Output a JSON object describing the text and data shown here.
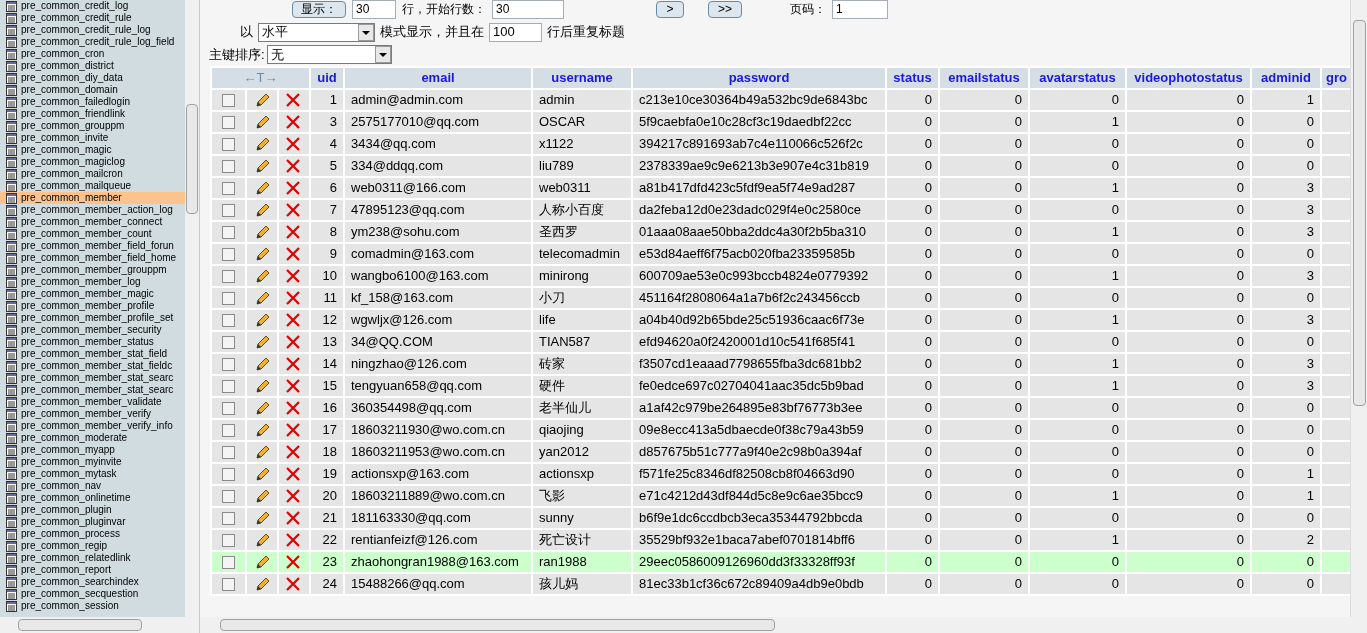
{
  "toolbar": {
    "show_button": "显示：",
    "rows_value": "30",
    "rows_label": "行，开始行数：",
    "start_value": "30",
    "next_button": ">",
    "last_button": ">>",
    "page_label": "页码：",
    "page_value": "1"
  },
  "display": {
    "prefix": "以",
    "mode_value": "水平",
    "mode_label": "模式显示，并且在",
    "repeat_value": "100",
    "repeat_label": "行后重复标题"
  },
  "sort": {
    "label": "主键排序:",
    "value": "无"
  },
  "sidebar": {
    "items": [
      {
        "label": "pre_common_credit_log",
        "selected": false
      },
      {
        "label": "pre_common_credit_rule",
        "selected": false
      },
      {
        "label": "pre_common_credit_rule_log",
        "selected": false
      },
      {
        "label": "pre_common_credit_rule_log_field",
        "selected": false
      },
      {
        "label": "pre_common_cron",
        "selected": false
      },
      {
        "label": "pre_common_district",
        "selected": false
      },
      {
        "label": "pre_common_diy_data",
        "selected": false
      },
      {
        "label": "pre_common_domain",
        "selected": false
      },
      {
        "label": "pre_common_failedlogin",
        "selected": false
      },
      {
        "label": "pre_common_friendlink",
        "selected": false
      },
      {
        "label": "pre_common_grouppm",
        "selected": false
      },
      {
        "label": "pre_common_invite",
        "selected": false
      },
      {
        "label": "pre_common_magic",
        "selected": false
      },
      {
        "label": "pre_common_magiclog",
        "selected": false
      },
      {
        "label": "pre_common_mailcron",
        "selected": false
      },
      {
        "label": "pre_common_mailqueue",
        "selected": false
      },
      {
        "label": "pre_common_member",
        "selected": true
      },
      {
        "label": "pre_common_member_action_log",
        "selected": false
      },
      {
        "label": "pre_common_member_connect",
        "selected": false
      },
      {
        "label": "pre_common_member_count",
        "selected": false
      },
      {
        "label": "pre_common_member_field_forun",
        "selected": false
      },
      {
        "label": "pre_common_member_field_home",
        "selected": false
      },
      {
        "label": "pre_common_member_grouppm",
        "selected": false
      },
      {
        "label": "pre_common_member_log",
        "selected": false
      },
      {
        "label": "pre_common_member_magic",
        "selected": false
      },
      {
        "label": "pre_common_member_profile",
        "selected": false
      },
      {
        "label": "pre_common_member_profile_set",
        "selected": false
      },
      {
        "label": "pre_common_member_security",
        "selected": false
      },
      {
        "label": "pre_common_member_status",
        "selected": false
      },
      {
        "label": "pre_common_member_stat_field",
        "selected": false
      },
      {
        "label": "pre_common_member_stat_fieldc",
        "selected": false
      },
      {
        "label": "pre_common_member_stat_searc",
        "selected": false
      },
      {
        "label": "pre_common_member_stat_searc",
        "selected": false
      },
      {
        "label": "pre_common_member_validate",
        "selected": false
      },
      {
        "label": "pre_common_member_verify",
        "selected": false
      },
      {
        "label": "pre_common_member_verify_info",
        "selected": false
      },
      {
        "label": "pre_common_moderate",
        "selected": false
      },
      {
        "label": "pre_common_myapp",
        "selected": false
      },
      {
        "label": "pre_common_myinvite",
        "selected": false
      },
      {
        "label": "pre_common_mytask",
        "selected": false
      },
      {
        "label": "pre_common_nav",
        "selected": false
      },
      {
        "label": "pre_common_onlinetime",
        "selected": false
      },
      {
        "label": "pre_common_plugin",
        "selected": false
      },
      {
        "label": "pre_common_pluginvar",
        "selected": false
      },
      {
        "label": "pre_common_process",
        "selected": false
      },
      {
        "label": "pre_common_regip",
        "selected": false
      },
      {
        "label": "pre_common_relatedlink",
        "selected": false
      },
      {
        "label": "pre_common_report",
        "selected": false
      },
      {
        "label": "pre_common_searchindex",
        "selected": false
      },
      {
        "label": "pre_common_secquestion",
        "selected": false
      },
      {
        "label": "pre_common_session",
        "selected": false
      }
    ]
  },
  "table": {
    "actions_header": "←T→",
    "columns": [
      "uid",
      "email",
      "username",
      "password",
      "status",
      "emailstatus",
      "avatarstatus",
      "videophotostatus",
      "adminid",
      "gro"
    ],
    "rows": [
      {
        "selected": false,
        "cells": [
          "1",
          "admin@admin.com",
          "admin",
          "c213e10ce30364b49a532bc9de6843bc",
          "0",
          "0",
          "0",
          "0",
          "1"
        ]
      },
      {
        "selected": false,
        "cells": [
          "3",
          "2575177010@qq.com",
          "OSCAR",
          "5f9caebfa0e10c28cf3c19daedbf22cc",
          "0",
          "0",
          "1",
          "0",
          "0"
        ]
      },
      {
        "selected": false,
        "cells": [
          "4",
          "3434@qq.com",
          "x1122",
          "394217c891693ab7c4e110066c526f2c",
          "0",
          "0",
          "0",
          "0",
          "0"
        ]
      },
      {
        "selected": false,
        "cells": [
          "5",
          "334@ddqq.com",
          "liu789",
          "2378339ae9c9e6213b3e907e4c31b819",
          "0",
          "0",
          "0",
          "0",
          "0"
        ]
      },
      {
        "selected": false,
        "cells": [
          "6",
          "web0311@166.com",
          "web0311",
          "a81b417dfd423c5fdf9ea5f74e9ad287",
          "0",
          "0",
          "1",
          "0",
          "3"
        ]
      },
      {
        "selected": false,
        "cells": [
          "7",
          "47895123@qq.com",
          "人称小百度",
          "da2feba12d0e23dadc029f4e0c2580ce",
          "0",
          "0",
          "0",
          "0",
          "3"
        ]
      },
      {
        "selected": false,
        "cells": [
          "8",
          "ym238@sohu.com",
          "圣西罗",
          "01aaa08aae50bba2ddc4a30f2b5ba310",
          "0",
          "0",
          "1",
          "0",
          "3"
        ]
      },
      {
        "selected": false,
        "cells": [
          "9",
          "comadmin@163.com",
          "telecomadmin",
          "e53d84aeff6f75acb020fba23359585b",
          "0",
          "0",
          "0",
          "0",
          "0"
        ]
      },
      {
        "selected": false,
        "cells": [
          "10",
          "wangbo6100@163.com",
          "minirong",
          "600709ae53e0c993bccb4824e0779392",
          "0",
          "0",
          "1",
          "0",
          "3"
        ]
      },
      {
        "selected": false,
        "cells": [
          "11",
          "kf_158@163.com",
          "小刀",
          "451164f2808064a1a7b6f2c243456ccb",
          "0",
          "0",
          "0",
          "0",
          "0"
        ]
      },
      {
        "selected": false,
        "cells": [
          "12",
          "wgwljx@126.com",
          "life",
          "a04b40d92b65bde25c51936caac6f73e",
          "0",
          "0",
          "1",
          "0",
          "3"
        ]
      },
      {
        "selected": false,
        "cells": [
          "13",
          "34@QQ.COM",
          "TIAN587",
          "efd94620a0f2420001d10c541f685f41",
          "0",
          "0",
          "0",
          "0",
          "0"
        ]
      },
      {
        "selected": false,
        "cells": [
          "14",
          "ningzhao@126.com",
          "砖家",
          "f3507cd1eaaad7798655fba3dc681bb2",
          "0",
          "0",
          "1",
          "0",
          "3"
        ]
      },
      {
        "selected": false,
        "cells": [
          "15",
          "tengyuan658@qq.com",
          "硬件",
          "fe0edce697c02704041aac35dc5b9bad",
          "0",
          "0",
          "1",
          "0",
          "3"
        ]
      },
      {
        "selected": false,
        "cells": [
          "16",
          "360354498@qq.com",
          "老半仙儿",
          "a1af42c979be264895e83bf76773b3ee",
          "0",
          "0",
          "0",
          "0",
          "0"
        ]
      },
      {
        "selected": false,
        "cells": [
          "17",
          "18603211930@wo.com.cn",
          "qiaojing",
          "09e8ecc413a5dbaecde0f38c79a43b59",
          "0",
          "0",
          "0",
          "0",
          "0"
        ]
      },
      {
        "selected": false,
        "cells": [
          "18",
          "18603211953@wo.com.cn",
          "yan2012",
          "d857675b51c777a9f40e2c98b0a394af",
          "0",
          "0",
          "0",
          "0",
          "0"
        ]
      },
      {
        "selected": false,
        "cells": [
          "19",
          "actionsxp@163.com",
          "actionsxp",
          "f571fe25c8346df82508cb8f04663d90",
          "0",
          "0",
          "0",
          "0",
          "1"
        ]
      },
      {
        "selected": false,
        "cells": [
          "20",
          "18603211889@wo.com.cn",
          "飞影",
          "e71c4212d43df844d5c8e9c6ae35bcc9",
          "0",
          "0",
          "1",
          "0",
          "1"
        ]
      },
      {
        "selected": false,
        "cells": [
          "21",
          "181163330@qq.com",
          "sunny",
          "b6f9e1dc6ccdbcb3eca35344792bbcda",
          "0",
          "0",
          "0",
          "0",
          "0"
        ]
      },
      {
        "selected": false,
        "cells": [
          "22",
          "rentianfeizf@126.com",
          "死亡设计",
          "35529bf932e1baca7abef0701814bff6",
          "0",
          "0",
          "1",
          "0",
          "2"
        ]
      },
      {
        "selected": true,
        "cells": [
          "23",
          "zhaohongran1988@163.com",
          "ran1988",
          "29eec0586009126960dd3f33328ff93f",
          "0",
          "0",
          "0",
          "0",
          "0"
        ]
      },
      {
        "selected": false,
        "cells": [
          "24",
          "15488266@qq.com",
          "孩儿妈",
          "81ec33b1cf36c672c89409a4db9e0bdb",
          "0",
          "0",
          "0",
          "0",
          "0"
        ]
      }
    ]
  }
}
